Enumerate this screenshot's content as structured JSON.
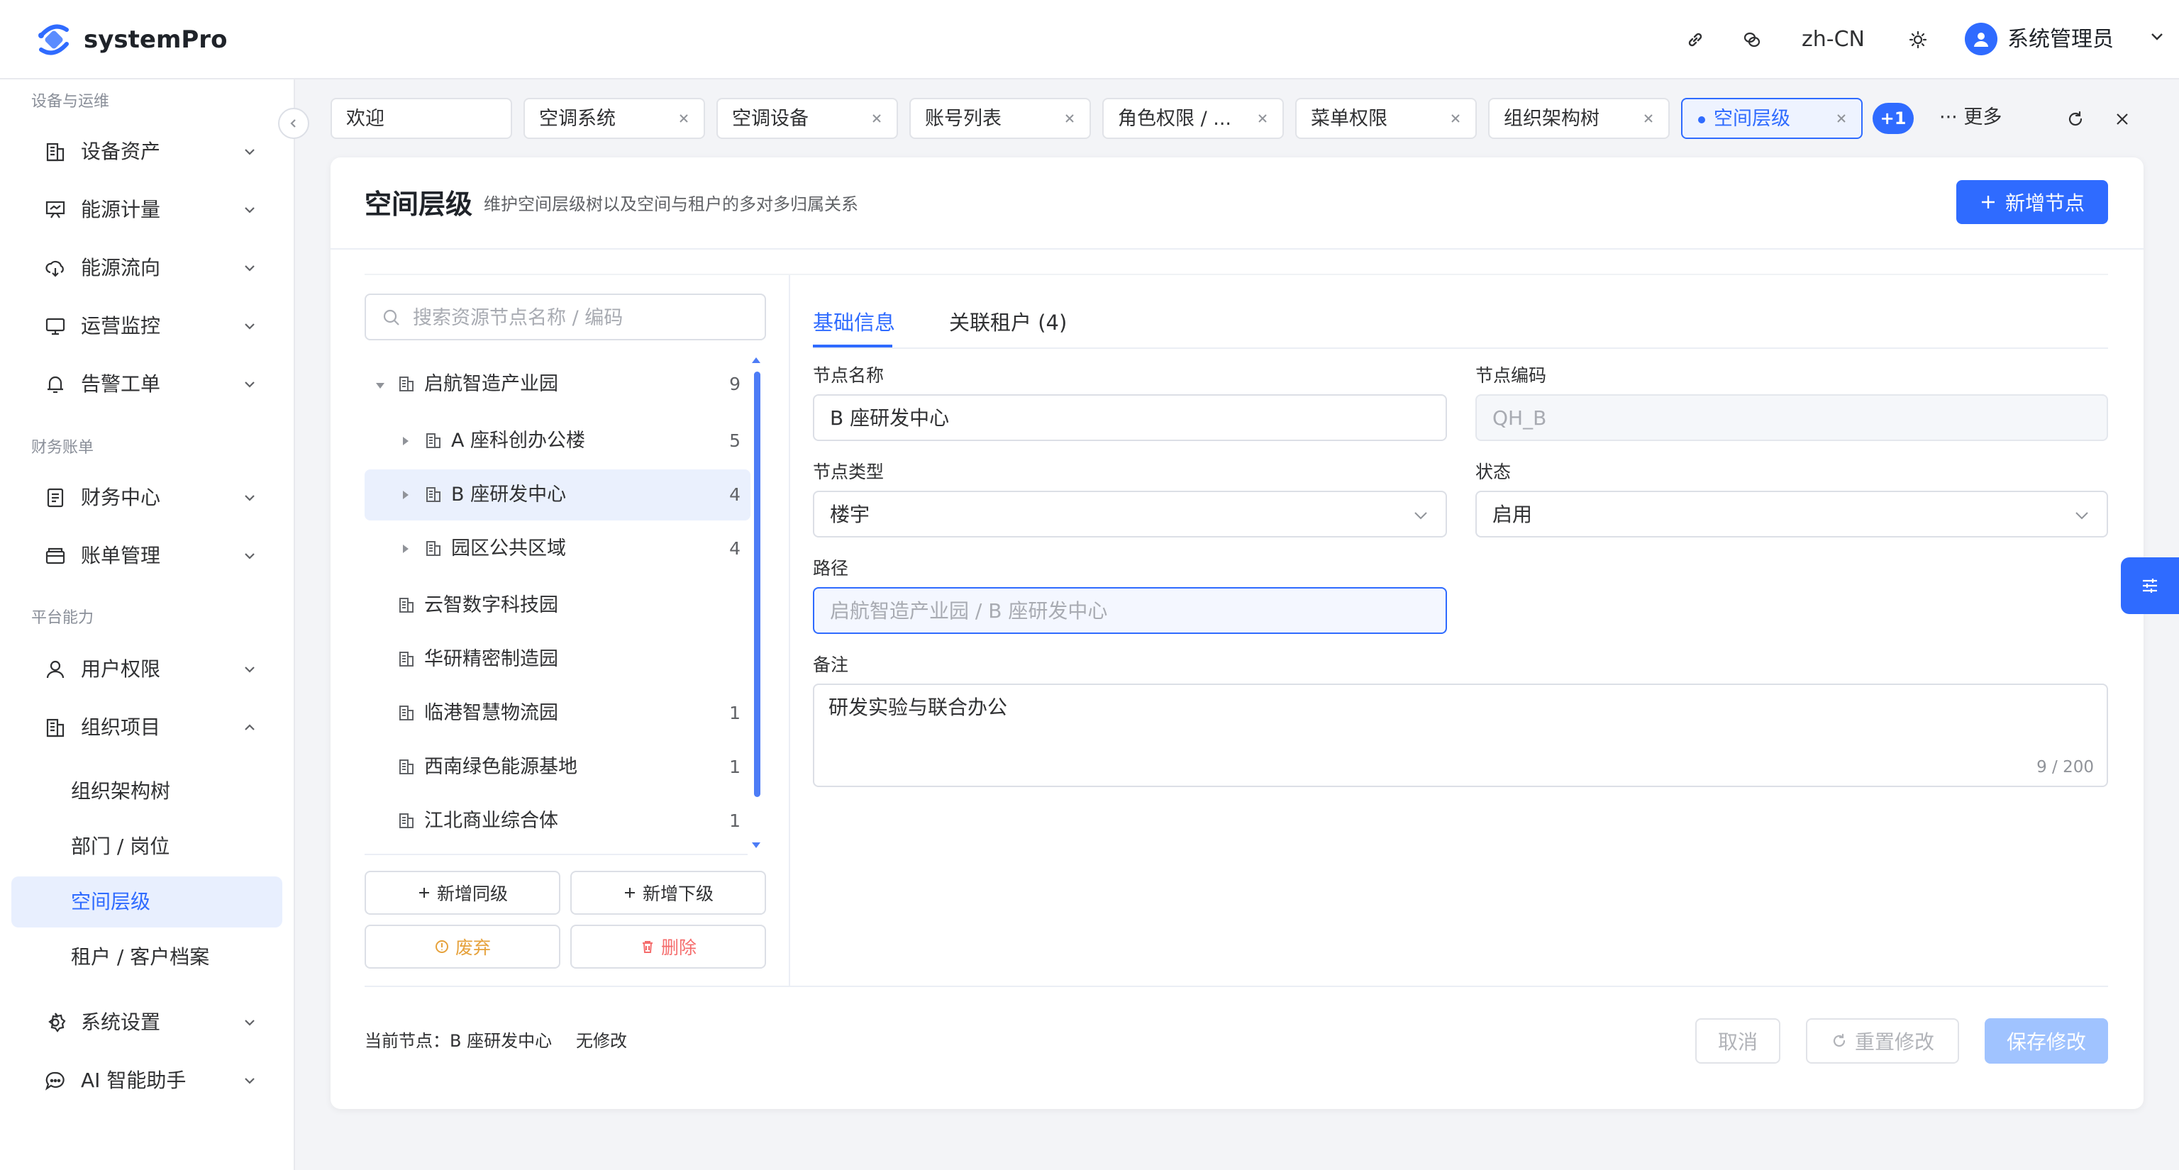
{
  "header": {
    "app_title": "systemPro",
    "lang": "zh-CN",
    "user_name": "系统管理员",
    "icons": [
      "link-icon",
      "chat-icon",
      "sun-icon",
      "user-avatar-icon",
      "chevron-down-icon"
    ]
  },
  "sidebar": {
    "groups": [
      {
        "label": "设备与运维"
      },
      {
        "label": "财务账单"
      },
      {
        "label": "平台能力"
      }
    ],
    "items": [
      {
        "label": "设备资产",
        "icon": "building-icon"
      },
      {
        "label": "能源计量",
        "icon": "meter-icon"
      },
      {
        "label": "能源流向",
        "icon": "cloud-flow-icon"
      },
      {
        "label": "运营监控",
        "icon": "monitor-icon"
      },
      {
        "label": "告警工单",
        "icon": "bell-icon"
      },
      {
        "label": "财务中心",
        "icon": "document-icon"
      },
      {
        "label": "账单管理",
        "icon": "wallet-icon"
      },
      {
        "label": "用户权限",
        "icon": "user-icon"
      },
      {
        "label": "组织项目",
        "icon": "building-icon"
      },
      {
        "label": "系统设置",
        "icon": "gear-icon"
      },
      {
        "label": "AI 智能助手",
        "icon": "chat-bubble-icon"
      }
    ],
    "sub_items": [
      {
        "label": "组织架构树"
      },
      {
        "label": "部门 / 岗位"
      },
      {
        "label": "空间层级"
      },
      {
        "label": "租户 / 客户档案"
      }
    ]
  },
  "tabs": {
    "items": [
      {
        "label": "欢迎"
      },
      {
        "label": "空调系统"
      },
      {
        "label": "空调设备"
      },
      {
        "label": "账号列表"
      },
      {
        "label": "角色权限 / ..."
      },
      {
        "label": "菜单权限"
      },
      {
        "label": "组织架构树"
      },
      {
        "label": "空间层级"
      }
    ],
    "overflow_badge": "+1",
    "more_label": "··· 更多"
  },
  "page": {
    "title": "空间层级",
    "description": "维护空间层级树以及空间与租户的多对多归属关系",
    "add_node_label": "新增节点"
  },
  "tree": {
    "search_placeholder": "搜索资源节点名称 / 编码",
    "nodes": [
      {
        "label": "启航智造产业园",
        "count": "9"
      },
      {
        "label": "A 座科创办公楼",
        "count": "5"
      },
      {
        "label": "B 座研发中心",
        "count": "4"
      },
      {
        "label": "园区公共区域",
        "count": "4"
      },
      {
        "label": "云智数字科技园",
        "count": ""
      },
      {
        "label": "华研精密制造园",
        "count": ""
      },
      {
        "label": "临港智慧物流园",
        "count": "1"
      },
      {
        "label": "西南绿色能源基地",
        "count": "1"
      },
      {
        "label": "江北商业综合体",
        "count": "1"
      }
    ],
    "actions": {
      "add_sibling": "新增同级",
      "add_child": "新增下级",
      "discard": "废弃",
      "delete": "删除"
    }
  },
  "form": {
    "tabs": [
      {
        "label": "基础信息"
      },
      {
        "label": "关联租户 (4)"
      }
    ],
    "name_label": "节点名称",
    "name_value": "B 座研发中心",
    "code_label": "节点编码",
    "code_value": "QH_B",
    "type_label": "节点类型",
    "type_value": "楼宇",
    "status_label": "状态",
    "status_value": "启用",
    "path_label": "路径",
    "path_value": "启航智造产业园 / B 座研发中心",
    "remark_label": "备注",
    "remark_value": "研发实验与联合办公",
    "remark_count": "9 / 200"
  },
  "footer": {
    "current_node": "当前节点：B 座研发中心",
    "modified_state": "无修改",
    "cancel_label": "取消",
    "reset_label": "重置修改",
    "save_label": "保存修改"
  },
  "colors": {
    "primary": "#2f6bff",
    "primary_light": "#e8effe",
    "warning": "#e6a23c",
    "danger": "#f56c6c",
    "disabled_primary": "#a0c3ff"
  }
}
